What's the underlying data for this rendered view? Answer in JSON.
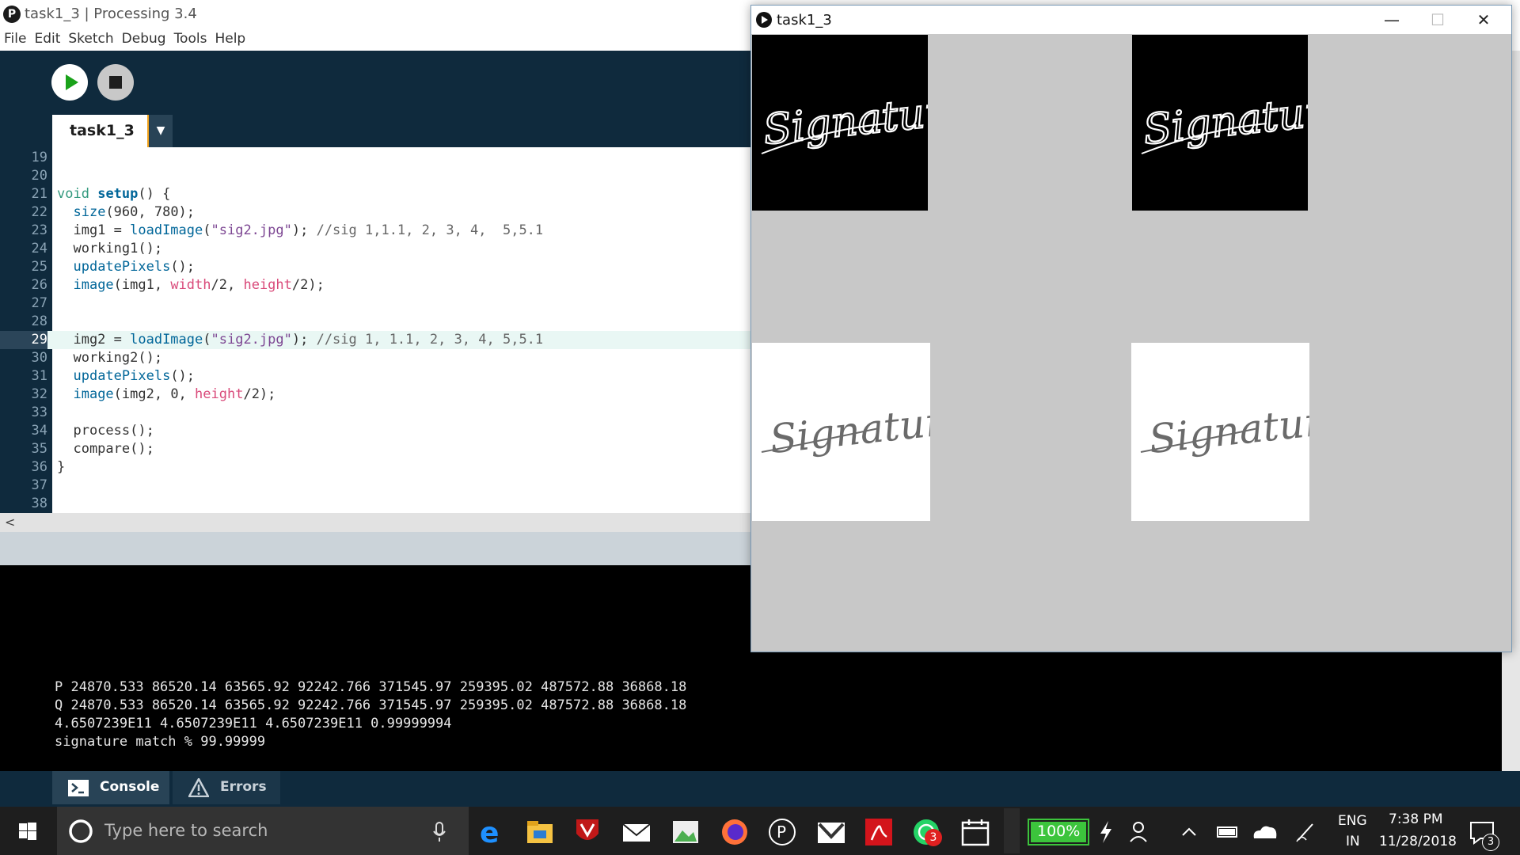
{
  "ide": {
    "window_title": "task1_3 | Processing 3.4",
    "logo_glyph": "P",
    "menu": [
      "File",
      "Edit",
      "Sketch",
      "Debug",
      "Tools",
      "Help"
    ],
    "tab_name": "task1_3",
    "tab_menu_glyph": "▼",
    "scroll_left_glyph": "<",
    "code_lines": [
      {
        "n": "19",
        "html": ""
      },
      {
        "n": "20",
        "html": ""
      },
      {
        "n": "21",
        "html": "<span class='kw'>void</span> <span class='fn'>setup</span>() {"
      },
      {
        "n": "22",
        "html": "  <span class='bi'>size</span>(960, 780);"
      },
      {
        "n": "23",
        "html": "  img1 = <span class='bi'>loadImage</span>(<span class='str'>\"sig2.jpg\"</span>); <span class='cm'>//sig 1,1.1, 2, 3, 4,  5,5.1</span>"
      },
      {
        "n": "24",
        "html": "  working1();"
      },
      {
        "n": "25",
        "html": "  <span class='bi'>updatePixels</span>();"
      },
      {
        "n": "26",
        "html": "  <span class='bi'>image</span>(img1, <span class='var'>width</span>/2, <span class='var'>height</span>/2);"
      },
      {
        "n": "27",
        "html": ""
      },
      {
        "n": "28",
        "html": ""
      },
      {
        "n": "29",
        "html": "  img2 = <span class='bi'>loadImage</span>(<span class='str'>\"sig2.jpg\"</span>); <span class='cm'>//sig 1, 1.1, 2, 3, 4, 5,5.1</span>",
        "highlight": true
      },
      {
        "n": "30",
        "html": "  working2();"
      },
      {
        "n": "31",
        "html": "  <span class='bi'>updatePixels</span>();"
      },
      {
        "n": "32",
        "html": "  <span class='bi'>image</span>(img2, 0, <span class='var'>height</span>/2);"
      },
      {
        "n": "33",
        "html": ""
      },
      {
        "n": "34",
        "html": "  process();"
      },
      {
        "n": "35",
        "html": "  compare();"
      },
      {
        "n": "36",
        "html": "}"
      },
      {
        "n": "37",
        "html": ""
      },
      {
        "n": "38",
        "html": ""
      }
    ],
    "console_lines": [
      "P 24870.533 86520.14 63565.92 92242.766 371545.97 259395.02 487572.88 36868.18",
      "Q 24870.533 86520.14 63565.92 92242.766 371545.97 259395.02 487572.88 36868.18",
      "4.6507239E11 4.6507239E11 4.6507239E11 0.99999994",
      "signature match % 99.99999"
    ],
    "console_tab_label": "Console",
    "errors_tab_label": "Errors"
  },
  "sketch_window": {
    "title": "task1_3",
    "minimize_glyph": "—",
    "maximize_glyph": "☐",
    "close_glyph": "✕",
    "signature_text": "Signature"
  },
  "taskbar": {
    "search_placeholder": "Type here to search",
    "battery": "100%",
    "language": "ENG",
    "region": "IN",
    "time": "7:38 PM",
    "date": "11/28/2018",
    "whatsapp_badge": "3",
    "notification_count": "3"
  },
  "colors": {
    "ide_dark": "#0f2a3d",
    "tab_accent": "#f3a41d",
    "run_green": "#1aa21a",
    "sketch_bg": "#c8c8c8"
  }
}
